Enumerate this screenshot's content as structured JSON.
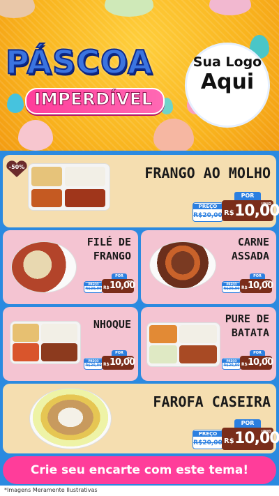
{
  "header": {
    "title": "PÁSCOA",
    "subtitle": "IMPERDÍVEL",
    "logo_line1": "Sua Logo",
    "logo_line2": "Aqui"
  },
  "badge": {
    "discount": "-50%"
  },
  "items": [
    {
      "name": "FRANGO AO MOLHO",
      "por": "POR",
      "preco": "PREÇO",
      "old_price": "R$20,00",
      "currency": "R$",
      "price": "10,00",
      "unit": "UNID"
    },
    {
      "name_line1": "FILÉ DE",
      "name_line2": "FRANGO",
      "por": "POR",
      "preco": "PREÇO",
      "old_price": "R$20,00",
      "currency": "R$",
      "price": "10,00",
      "unit": "UNID"
    },
    {
      "name_line1": "CARNE",
      "name_line2": "ASSADA",
      "por": "POR",
      "preco": "PREÇO",
      "old_price": "R$20,00",
      "currency": "R$",
      "price": "10,00",
      "unit": "UNID"
    },
    {
      "name": "NHOQUE",
      "por": "POR",
      "preco": "PREÇO",
      "old_price": "R$20,00",
      "currency": "R$",
      "price": "10,00",
      "unit": "UNID"
    },
    {
      "name_line1": "PURE DE",
      "name_line2": "BATATA",
      "por": "POR",
      "preco": "PREÇO",
      "old_price": "R$20,00",
      "currency": "R$",
      "price": "10,00",
      "unit": "UNID"
    },
    {
      "name": "FAROFA CASEIRA",
      "por": "POR",
      "preco": "PREÇO",
      "old_price": "R$20,00",
      "currency": "R$",
      "price": "10,00",
      "unit": "UNID"
    }
  ],
  "cta": "Crie seu encarte com este tema!",
  "footnote": "*Imagens Meramente Ilustrativas",
  "colors": {
    "header_yellow": "#f9b51f",
    "content_blue": "#2b8ae0",
    "card_beige": "#f5deb0",
    "card_pink": "#f4c4d2",
    "price_brown": "#7a2d1a",
    "cta_pink": "#ff3d9a"
  }
}
